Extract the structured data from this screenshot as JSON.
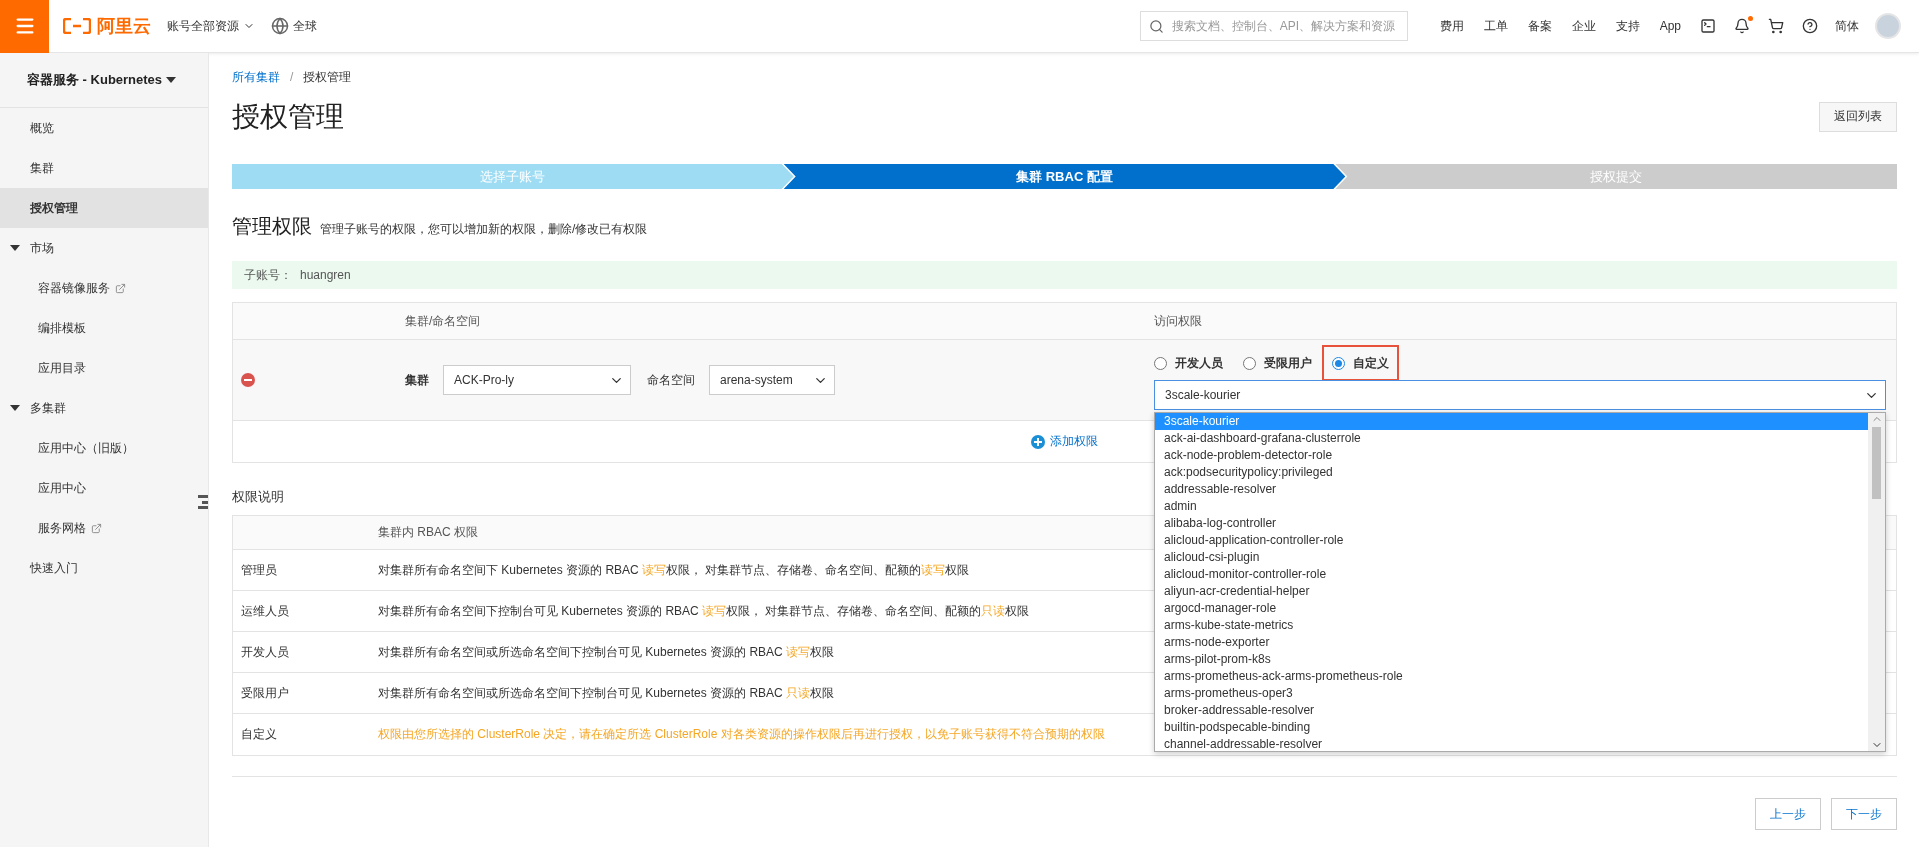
{
  "topbar": {
    "logo": "阿里云",
    "account_scope": "账号全部资源",
    "region": "全球",
    "search": {
      "placeholder": "搜索文档、控制台、API、解决方案和资源"
    },
    "links": [
      "费用",
      "工单",
      "备案",
      "企业",
      "支持",
      "App"
    ],
    "notification": true,
    "language": "简体"
  },
  "sidebar": {
    "title": "容器服务 - Kubernetes",
    "items": [
      {
        "label": "概览",
        "kind": "link",
        "selected": false
      },
      {
        "label": "集群",
        "kind": "link",
        "selected": false
      },
      {
        "label": "授权管理",
        "kind": "link",
        "selected": true
      },
      {
        "label": "市场",
        "kind": "group",
        "selected": false,
        "expanded": true,
        "children": [
          {
            "label": "容器镜像服务",
            "selected": false,
            "external": true
          },
          {
            "label": "编排模板",
            "selected": false,
            "external": false
          },
          {
            "label": "应用目录",
            "selected": false,
            "external": false
          }
        ]
      },
      {
        "label": "多集群",
        "kind": "group",
        "selected": false,
        "expanded": true,
        "children": [
          {
            "label": "应用中心（旧版）",
            "selected": false,
            "external": false
          },
          {
            "label": "应用中心",
            "selected": false,
            "external": false
          },
          {
            "label": "服务网格",
            "selected": false,
            "external": true
          }
        ]
      },
      {
        "label": "快速入门",
        "kind": "link",
        "selected": false
      }
    ]
  },
  "breadcrumb": {
    "separator": "/",
    "items": [
      {
        "label": "所有集群",
        "link": true
      },
      {
        "label": "授权管理",
        "link": false
      }
    ]
  },
  "page": {
    "title": "授权管理",
    "back_button": "返回列表"
  },
  "steps": [
    {
      "label": "选择子账号",
      "done": true,
      "selected": false
    },
    {
      "label": "集群 RBAC 配置",
      "done": false,
      "selected": true
    },
    {
      "label": "授权提交",
      "done": false,
      "selected": false
    }
  ],
  "section": {
    "title": "管理权限",
    "description": "管理子账号的权限，您可以增加新的权限，删除/修改已有权限"
  },
  "account": {
    "label": "子账号：",
    "value": "huangren"
  },
  "permissions_table": {
    "columns": [
      "集群/命名空间",
      "访问权限"
    ],
    "add_button": "添加权限",
    "rows": [
      {
        "cluster_label": "集群",
        "cluster": "ACK-Pro-ly",
        "namespace_label": "命名空间",
        "namespace": "arena-system",
        "roles": [
          {
            "label": "开发人员",
            "selected": false,
            "highlighted": false
          },
          {
            "label": "受限用户",
            "selected": false,
            "highlighted": false
          },
          {
            "label": "自定义",
            "selected": true,
            "highlighted": true
          }
        ],
        "clusterrole": {
          "value": "3scale-kourier",
          "expanded": true,
          "options": [
            {
              "label": "3scale-kourier",
              "selected": true
            },
            {
              "label": "ack-ai-dashboard-grafana-clusterrole",
              "selected": false
            },
            {
              "label": "ack-node-problem-detector-role",
              "selected": false
            },
            {
              "label": "ack:podsecuritypolicy:privileged",
              "selected": false
            },
            {
              "label": "addressable-resolver",
              "selected": false
            },
            {
              "label": "admin",
              "selected": false
            },
            {
              "label": "alibaba-log-controller",
              "selected": false
            },
            {
              "label": "alicloud-application-controller-role",
              "selected": false
            },
            {
              "label": "alicloud-csi-plugin",
              "selected": false
            },
            {
              "label": "alicloud-monitor-controller-role",
              "selected": false
            },
            {
              "label": "aliyun-acr-credential-helper",
              "selected": false
            },
            {
              "label": "argocd-manager-role",
              "selected": false
            },
            {
              "label": "arms-kube-state-metrics",
              "selected": false
            },
            {
              "label": "arms-node-exporter",
              "selected": false
            },
            {
              "label": "arms-pilot-prom-k8s",
              "selected": false
            },
            {
              "label": "arms-prometheus-ack-arms-prometheus-role",
              "selected": false
            },
            {
              "label": "arms-prometheus-oper3",
              "selected": false
            },
            {
              "label": "broker-addressable-resolver",
              "selected": false
            },
            {
              "label": "builtin-podspecable-binding",
              "selected": false
            },
            {
              "label": "channel-addressable-resolver",
              "selected": false
            }
          ]
        }
      }
    ]
  },
  "explanation": {
    "title": "权限说明",
    "column_header": "集群内 RBAC 权限",
    "rows": [
      {
        "role": "管理员",
        "description": [
          {
            "text": "对集群所有命名空间下 Kubernetes 资源的 RBAC ",
            "highlight": false
          },
          {
            "text": "读写",
            "highlight": true
          },
          {
            "text": "权限， 对集群节点、存储卷、命名空间、配额的",
            "highlight": false
          },
          {
            "text": "读写",
            "highlight": true
          },
          {
            "text": "权限",
            "highlight": false
          }
        ]
      },
      {
        "role": "运维人员",
        "description": [
          {
            "text": "对集群所有命名空间下控制台可见 Kubernetes 资源的 RBAC ",
            "highlight": false
          },
          {
            "text": "读写",
            "highlight": true
          },
          {
            "text": "权限， 对集群节点、存储卷、命名空间、配额的",
            "highlight": false
          },
          {
            "text": "只读",
            "highlight": true
          },
          {
            "text": "权限",
            "highlight": false
          }
        ]
      },
      {
        "role": "开发人员",
        "description": [
          {
            "text": "对集群所有命名空间或所选命名空间下控制台可见 Kubernetes 资源的 RBAC ",
            "highlight": false
          },
          {
            "text": "读写",
            "highlight": true
          },
          {
            "text": "权限",
            "highlight": false
          }
        ]
      },
      {
        "role": "受限用户",
        "description": [
          {
            "text": "对集群所有命名空间或所选命名空间下控制台可见 Kubernetes 资源的 RBAC ",
            "highlight": false
          },
          {
            "text": "只读",
            "highlight": true
          },
          {
            "text": "权限",
            "highlight": false
          }
        ]
      },
      {
        "role": "自定义",
        "description": [
          {
            "text": "权限由您所选择的 ClusterRole 决定，请在确定所选 ClusterRole 对各类资源的操作权限后再进行授权，以免子账号获得不符合预期的权限",
            "highlight": true
          }
        ]
      }
    ]
  },
  "footer": {
    "buttons": [
      "上一步",
      "下一步"
    ]
  }
}
